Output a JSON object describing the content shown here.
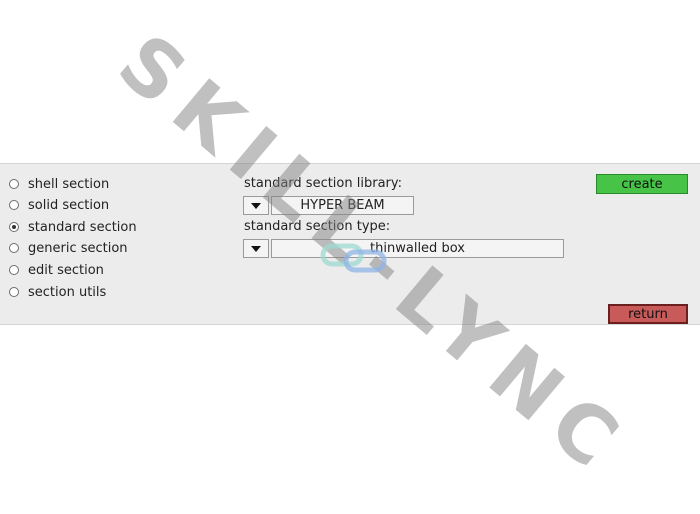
{
  "section_types": [
    {
      "label": "shell section",
      "checked": false
    },
    {
      "label": "solid section",
      "checked": false
    },
    {
      "label": "standard section",
      "checked": true
    },
    {
      "label": "generic section",
      "checked": false
    },
    {
      "label": "edit section",
      "checked": false
    },
    {
      "label": "section utils",
      "checked": false
    }
  ],
  "library": {
    "label": "standard section library:",
    "value": "HYPER BEAM"
  },
  "section_type": {
    "label": "standard section type:",
    "value": "thinwalled box"
  },
  "buttons": {
    "create": "create",
    "return": "return"
  },
  "watermark": {
    "text": "SKILL-LYNC"
  },
  "colors": {
    "create_bg": "#47c447",
    "return_bg": "#c85a5a",
    "panel_bg": "#ececec"
  }
}
